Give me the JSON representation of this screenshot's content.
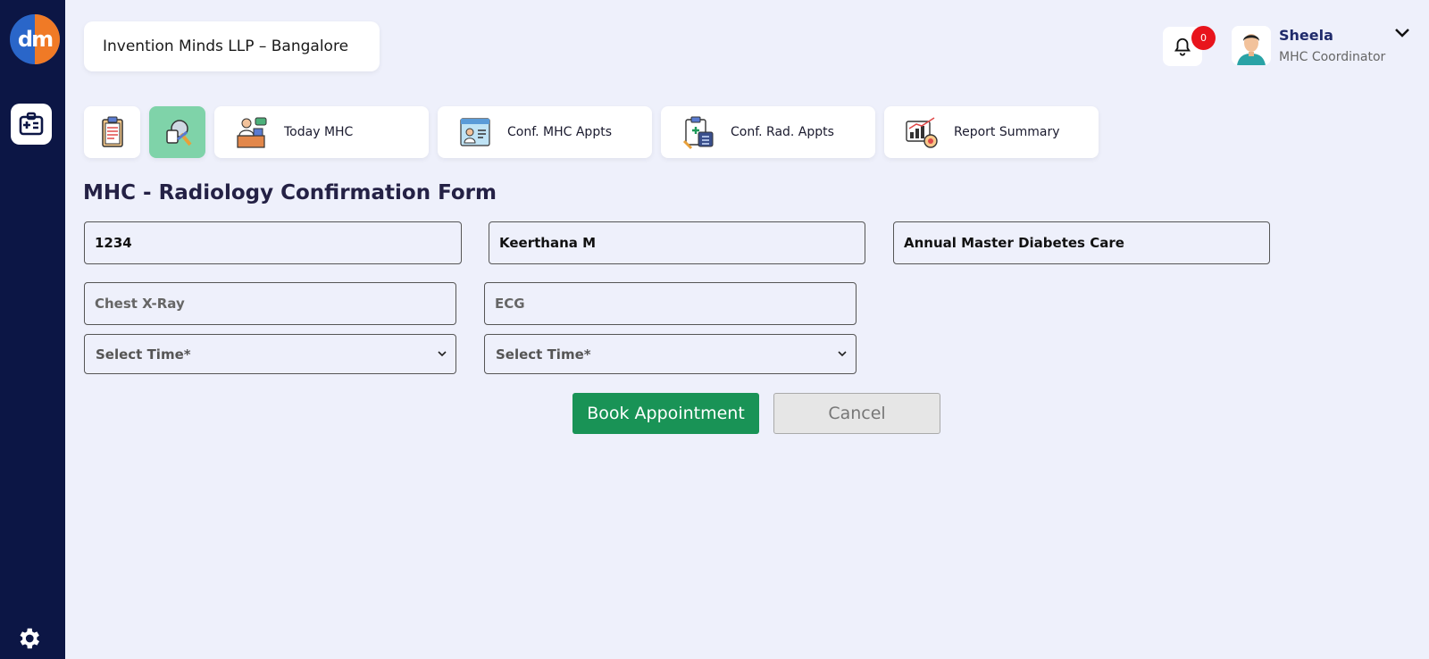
{
  "app": {
    "logo_text": "dm"
  },
  "header": {
    "org_name": "Invention Minds LLP – Bangalore",
    "notification_count": "0",
    "user_name": "Sheela",
    "user_role": "MHC Coordinator"
  },
  "nav": {
    "tiles": [
      {
        "label": "Today MHC",
        "icon": "doctor-desk-icon"
      },
      {
        "label": "Conf. MHC Appts",
        "icon": "doctor-profile-icon"
      },
      {
        "label": "Conf. Rad. Appts",
        "icon": "clipboard-xray-icon"
      },
      {
        "label": "Report Summary",
        "icon": "report-chart-icon"
      }
    ]
  },
  "form": {
    "title": "MHC - Radiology Confirmation Form",
    "employee_id": "1234",
    "employee_name": "Keerthana M",
    "package_name": "Annual Master Diabetes Care",
    "test_1": "Chest X-Ray",
    "test_2": "ECG",
    "time_1_placeholder": "Select Time*",
    "time_2_placeholder": "Select Time*",
    "book_label": "Book Appointment",
    "cancel_label": "Cancel"
  },
  "colors": {
    "sidebar": "#0c1645",
    "accent_green": "#199356",
    "active_tile": "#7fd3a9",
    "badge_red": "#e8141c"
  }
}
